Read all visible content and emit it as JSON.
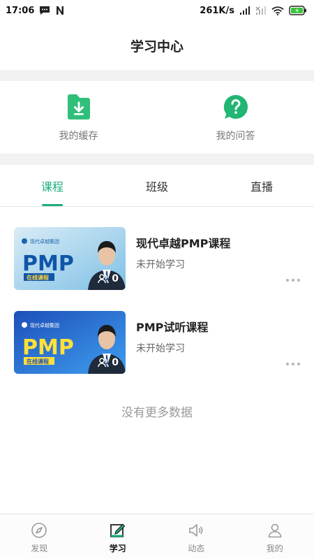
{
  "status_bar": {
    "time": "17:06",
    "network_speed": "261K/s"
  },
  "header": {
    "title": "学习中心"
  },
  "quick_actions": [
    {
      "label": "我的缓存",
      "icon": "download-folder-icon"
    },
    {
      "label": "我的问答",
      "icon": "question-bubble-icon"
    }
  ],
  "tabs": [
    {
      "label": "课程",
      "active": true
    },
    {
      "label": "班级",
      "active": false
    },
    {
      "label": "直播",
      "active": false
    }
  ],
  "courses": [
    {
      "title": "现代卓越PMP课程",
      "status": "未开始学习",
      "learners": "0",
      "thumb_brand": "现代卓越集团",
      "thumb_main": "PMP",
      "thumb_tag": "在线课程"
    },
    {
      "title": "PMP试听课程",
      "status": "未开始学习",
      "learners": "0",
      "thumb_brand": "现代卓越集团",
      "thumb_main": "PMP",
      "thumb_tag": "在线课程"
    }
  ],
  "list_end": "没有更多数据",
  "bottom_nav": [
    {
      "label": "发现",
      "icon": "compass-icon",
      "active": false
    },
    {
      "label": "学习",
      "icon": "study-icon",
      "active": true
    },
    {
      "label": "动态",
      "icon": "speaker-icon",
      "active": false
    },
    {
      "label": "我的",
      "icon": "profile-icon",
      "active": false
    }
  ],
  "colors": {
    "accent": "#1fae7e",
    "question_icon": "#22b573",
    "folder_icon": "#2fbf79"
  }
}
